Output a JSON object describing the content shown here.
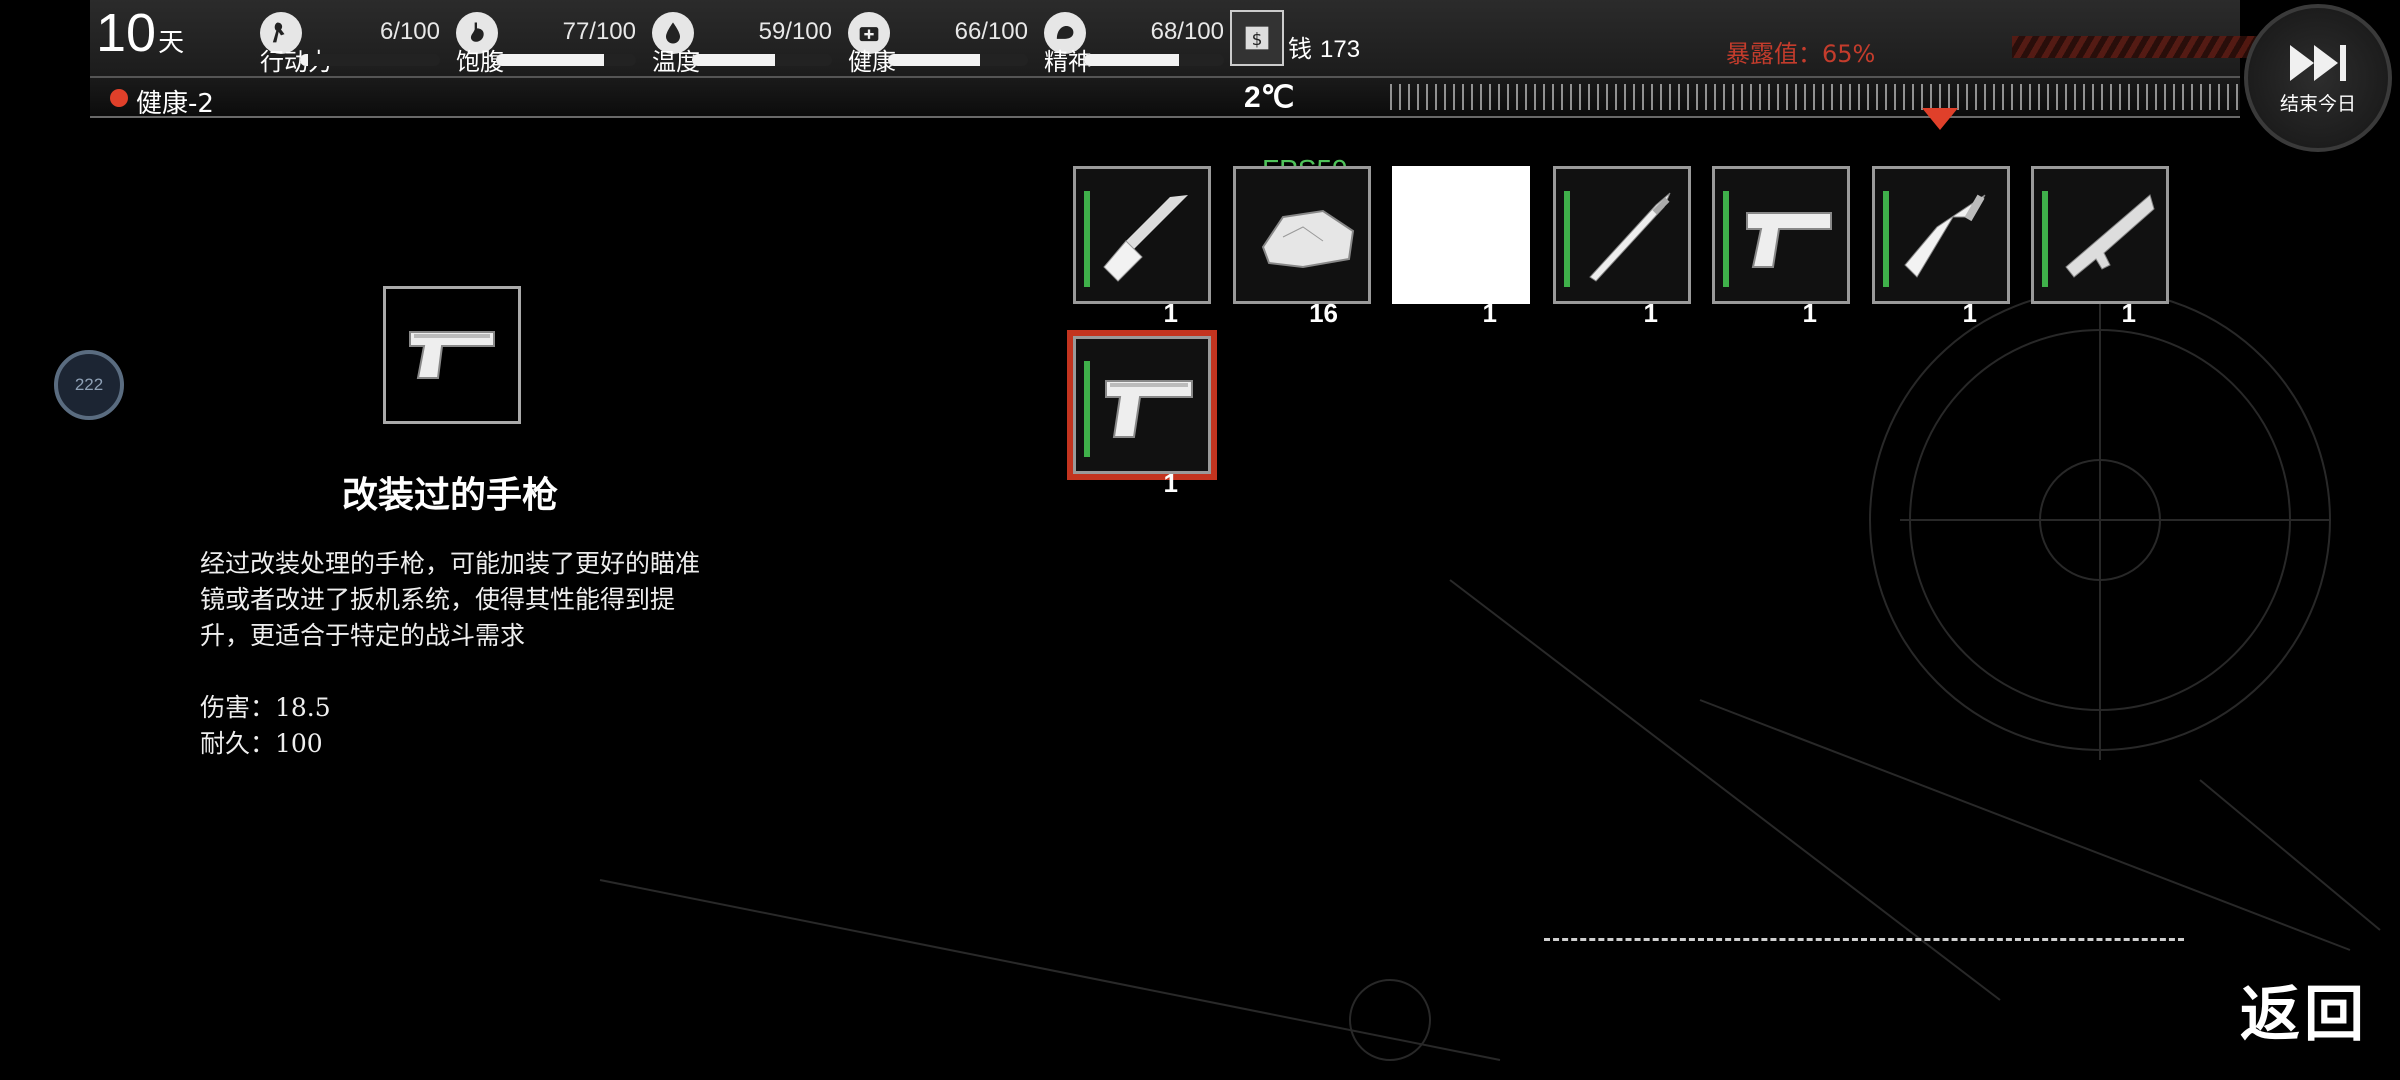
{
  "hud": {
    "day_number": "10",
    "day_unit": "天",
    "stats": [
      {
        "label": "行动力",
        "value": "6/100",
        "level": 0.06,
        "icon": "action-icon"
      },
      {
        "label": "饱腹",
        "value": "77/100",
        "level": 0.77,
        "icon": "stomach-icon"
      },
      {
        "label": "温度",
        "value": "59/100",
        "level": 0.59,
        "icon": "temperature-icon"
      },
      {
        "label": "健康",
        "value": "66/100",
        "level": 0.66,
        "icon": "health-icon"
      },
      {
        "label": "精神",
        "value": "68/100",
        "level": 0.68,
        "icon": "spirit-icon"
      }
    ],
    "money_label": "钱",
    "money_amount": "173",
    "exposure": "暴露值：65%",
    "status": "健康-2",
    "temperature": "2℃",
    "end_day_label": "结束今日"
  },
  "side_badge": "222",
  "detail": {
    "title": "改装过的手枪",
    "description": "经过改装处理的手枪，可能加装了更好的瞄准镜或者改进了扳机系统，使得其性能得到提升，更适合于特定的战斗需求",
    "damage": "伤害：18.5",
    "durability": "耐久：100"
  },
  "fps": "FPS59",
  "inventory": [
    {
      "item": "shovel-icon",
      "qty": "1",
      "durability": true
    },
    {
      "item": "ore-icon",
      "qty": "16",
      "durability": false
    },
    {
      "item": "blank",
      "qty": "1",
      "durability": false
    },
    {
      "item": "katana-icon",
      "qty": "1",
      "durability": true
    },
    {
      "item": "pistol-icon",
      "qty": "1",
      "durability": true
    },
    {
      "item": "cleaver-icon",
      "qty": "1",
      "durability": true
    },
    {
      "item": "rifle-icon",
      "qty": "1",
      "durability": true
    },
    {
      "item": "modified-pistol-icon",
      "qty": "1",
      "durability": true
    }
  ],
  "back_label": "返回",
  "colors": {
    "accent": "#c3341f",
    "durability": "#3fb04a",
    "exposure": "#c43c2c"
  }
}
